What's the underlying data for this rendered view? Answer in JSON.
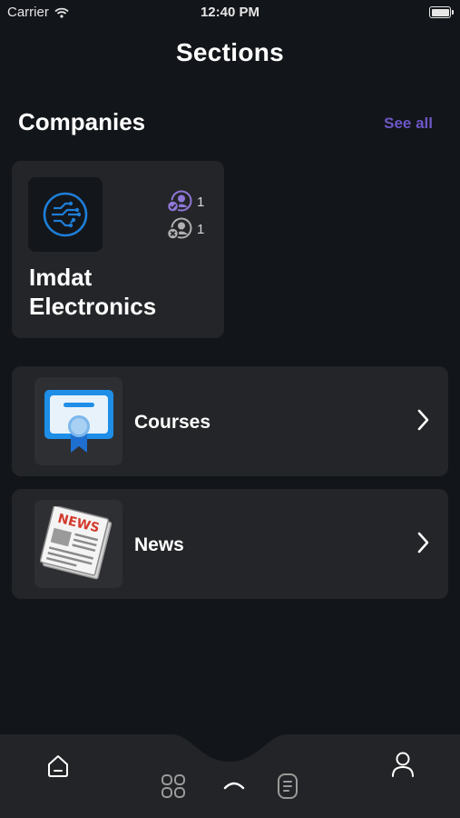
{
  "status_bar": {
    "carrier": "Carrier",
    "time": "12:40 PM"
  },
  "page": {
    "title": "Sections"
  },
  "companies": {
    "title": "Companies",
    "see_all": "See all",
    "card": {
      "name": "Imdat Electronics",
      "logo_icon": "circuit-logo-icon",
      "approved_count": "1",
      "rejected_count": "1"
    }
  },
  "menu": [
    {
      "label": "Courses",
      "icon": "certificate-icon"
    },
    {
      "label": "News",
      "icon": "newspaper-icon"
    }
  ],
  "tab_bar": {
    "items": [
      "home-icon",
      "grid-icon",
      "center-action-icon",
      "document-icon",
      "profile-icon"
    ]
  },
  "colors": {
    "background": "#121519",
    "card": "#242528",
    "accent": "#6e56c7",
    "tab_bar": "#232427"
  }
}
